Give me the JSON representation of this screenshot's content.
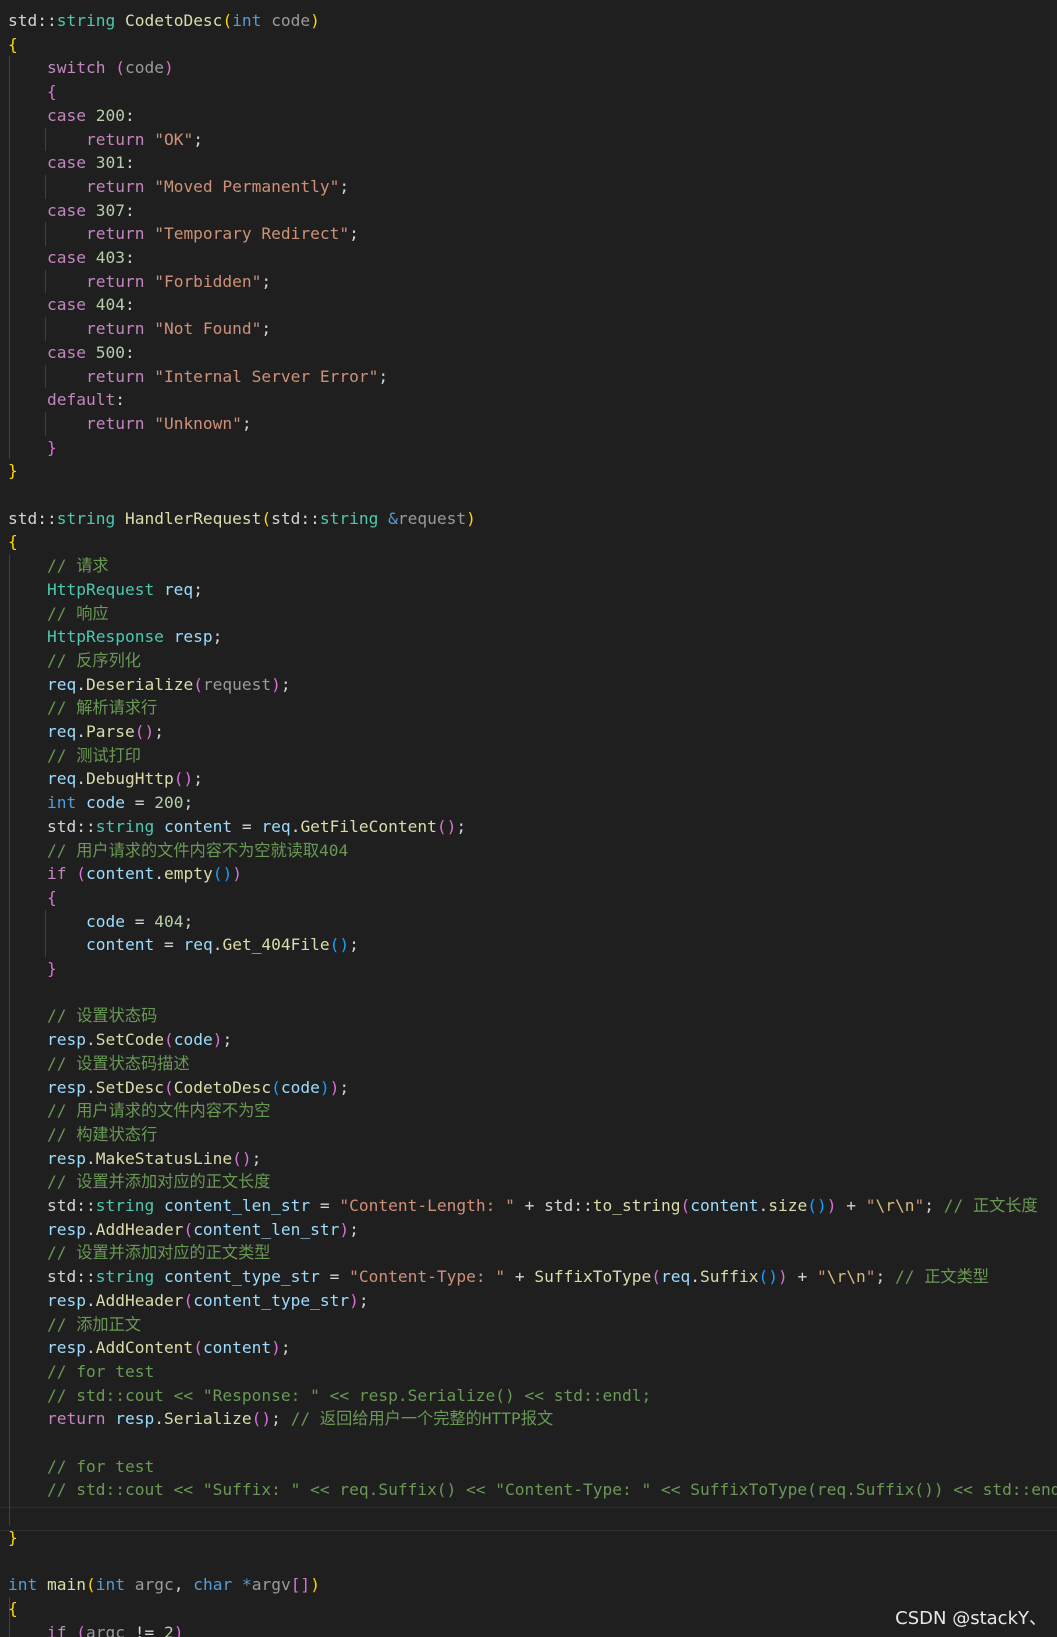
{
  "editor": {
    "theme_colors": {
      "background": "#1f1f1f",
      "keyword": "#569cd6",
      "control": "#c586c0",
      "type": "#4ec9b0",
      "function": "#dcdcaa",
      "string": "#ce9178",
      "number": "#b5cea8",
      "comment": "#6a9955",
      "bracket_1": "#ffd700",
      "bracket_2": "#da70d6",
      "bracket_3": "#179fff"
    },
    "lines": [
      [
        [
          "pl",
          "std::"
        ],
        [
          "ty",
          "string"
        ],
        [
          "pl",
          " "
        ],
        [
          "fn",
          "CodetoDesc"
        ],
        [
          "b1",
          "("
        ],
        [
          "kw",
          "int"
        ],
        [
          "pl",
          " "
        ],
        [
          "par",
          "code"
        ],
        [
          "b1",
          ")"
        ]
      ],
      [
        [
          "b1",
          "{"
        ]
      ],
      [
        [
          "pl",
          "    "
        ],
        [
          "ctl",
          "switch"
        ],
        [
          "pl",
          " "
        ],
        [
          "b2",
          "("
        ],
        [
          "par",
          "code"
        ],
        [
          "b2",
          ")"
        ]
      ],
      [
        [
          "pl",
          "    "
        ],
        [
          "b2",
          "{"
        ]
      ],
      [
        [
          "pl",
          "    "
        ],
        [
          "ctl",
          "case"
        ],
        [
          "pl",
          " "
        ],
        [
          "num",
          "200"
        ],
        [
          "pl",
          ":"
        ]
      ],
      [
        [
          "pl",
          "        "
        ],
        [
          "ctl",
          "return"
        ],
        [
          "pl",
          " "
        ],
        [
          "str",
          "\"OK\""
        ],
        [
          "pl",
          ";"
        ]
      ],
      [
        [
          "pl",
          "    "
        ],
        [
          "ctl",
          "case"
        ],
        [
          "pl",
          " "
        ],
        [
          "num",
          "301"
        ],
        [
          "pl",
          ":"
        ]
      ],
      [
        [
          "pl",
          "        "
        ],
        [
          "ctl",
          "return"
        ],
        [
          "pl",
          " "
        ],
        [
          "str",
          "\"Moved Permanently\""
        ],
        [
          "pl",
          ";"
        ]
      ],
      [
        [
          "pl",
          "    "
        ],
        [
          "ctl",
          "case"
        ],
        [
          "pl",
          " "
        ],
        [
          "num",
          "307"
        ],
        [
          "pl",
          ":"
        ]
      ],
      [
        [
          "pl",
          "        "
        ],
        [
          "ctl",
          "return"
        ],
        [
          "pl",
          " "
        ],
        [
          "str",
          "\"Temporary Redirect\""
        ],
        [
          "pl",
          ";"
        ]
      ],
      [
        [
          "pl",
          "    "
        ],
        [
          "ctl",
          "case"
        ],
        [
          "pl",
          " "
        ],
        [
          "num",
          "403"
        ],
        [
          "pl",
          ":"
        ]
      ],
      [
        [
          "pl",
          "        "
        ],
        [
          "ctl",
          "return"
        ],
        [
          "pl",
          " "
        ],
        [
          "str",
          "\"Forbidden\""
        ],
        [
          "pl",
          ";"
        ]
      ],
      [
        [
          "pl",
          "    "
        ],
        [
          "ctl",
          "case"
        ],
        [
          "pl",
          " "
        ],
        [
          "num",
          "404"
        ],
        [
          "pl",
          ":"
        ]
      ],
      [
        [
          "pl",
          "        "
        ],
        [
          "ctl",
          "return"
        ],
        [
          "pl",
          " "
        ],
        [
          "str",
          "\"Not Found\""
        ],
        [
          "pl",
          ";"
        ]
      ],
      [
        [
          "pl",
          "    "
        ],
        [
          "ctl",
          "case"
        ],
        [
          "pl",
          " "
        ],
        [
          "num",
          "500"
        ],
        [
          "pl",
          ":"
        ]
      ],
      [
        [
          "pl",
          "        "
        ],
        [
          "ctl",
          "return"
        ],
        [
          "pl",
          " "
        ],
        [
          "str",
          "\"Internal Server Error\""
        ],
        [
          "pl",
          ";"
        ]
      ],
      [
        [
          "pl",
          "    "
        ],
        [
          "ctl",
          "default"
        ],
        [
          "pl",
          ":"
        ]
      ],
      [
        [
          "pl",
          "        "
        ],
        [
          "ctl",
          "return"
        ],
        [
          "pl",
          " "
        ],
        [
          "str",
          "\"Unknown\""
        ],
        [
          "pl",
          ";"
        ]
      ],
      [
        [
          "pl",
          "    "
        ],
        [
          "b2",
          "}"
        ]
      ],
      [
        [
          "b1",
          "}"
        ]
      ],
      [],
      [
        [
          "pl",
          "std::"
        ],
        [
          "ty",
          "string"
        ],
        [
          "pl",
          " "
        ],
        [
          "fn",
          "HandlerRequest"
        ],
        [
          "b1",
          "("
        ],
        [
          "pl",
          "std::"
        ],
        [
          "ty",
          "string"
        ],
        [
          "pl",
          " "
        ],
        [
          "kw",
          "&"
        ],
        [
          "par",
          "request"
        ],
        [
          "b1",
          ")"
        ]
      ],
      [
        [
          "b1",
          "{"
        ]
      ],
      [
        [
          "pl",
          "    "
        ],
        [
          "com",
          "// 请求"
        ]
      ],
      [
        [
          "pl",
          "    "
        ],
        [
          "ty",
          "HttpRequest"
        ],
        [
          "pl",
          " "
        ],
        [
          "var",
          "req"
        ],
        [
          "pl",
          ";"
        ]
      ],
      [
        [
          "pl",
          "    "
        ],
        [
          "com",
          "// 响应"
        ]
      ],
      [
        [
          "pl",
          "    "
        ],
        [
          "ty",
          "HttpResponse"
        ],
        [
          "pl",
          " "
        ],
        [
          "var",
          "resp"
        ],
        [
          "pl",
          ";"
        ]
      ],
      [
        [
          "pl",
          "    "
        ],
        [
          "com",
          "// 反序列化"
        ]
      ],
      [
        [
          "pl",
          "    "
        ],
        [
          "var",
          "req"
        ],
        [
          "pl",
          "."
        ],
        [
          "fn",
          "Deserialize"
        ],
        [
          "b2",
          "("
        ],
        [
          "par",
          "request"
        ],
        [
          "b2",
          ")"
        ],
        [
          "pl",
          ";"
        ]
      ],
      [
        [
          "pl",
          "    "
        ],
        [
          "com",
          "// 解析请求行"
        ]
      ],
      [
        [
          "pl",
          "    "
        ],
        [
          "var",
          "req"
        ],
        [
          "pl",
          "."
        ],
        [
          "fn",
          "Parse"
        ],
        [
          "b2",
          "()"
        ],
        [
          "pl",
          ";"
        ]
      ],
      [
        [
          "pl",
          "    "
        ],
        [
          "com",
          "// 测试打印"
        ]
      ],
      [
        [
          "pl",
          "    "
        ],
        [
          "var",
          "req"
        ],
        [
          "pl",
          "."
        ],
        [
          "fn",
          "DebugHttp"
        ],
        [
          "b2",
          "()"
        ],
        [
          "pl",
          ";"
        ]
      ],
      [
        [
          "pl",
          "    "
        ],
        [
          "kw",
          "int"
        ],
        [
          "pl",
          " "
        ],
        [
          "var",
          "code"
        ],
        [
          "pl",
          " = "
        ],
        [
          "num",
          "200"
        ],
        [
          "pl",
          ";"
        ]
      ],
      [
        [
          "pl",
          "    std::"
        ],
        [
          "ty",
          "string"
        ],
        [
          "pl",
          " "
        ],
        [
          "var",
          "content"
        ],
        [
          "pl",
          " = "
        ],
        [
          "var",
          "req"
        ],
        [
          "pl",
          "."
        ],
        [
          "fn",
          "GetFileContent"
        ],
        [
          "b2",
          "()"
        ],
        [
          "pl",
          ";"
        ]
      ],
      [
        [
          "pl",
          "    "
        ],
        [
          "com",
          "// 用户请求的文件内容不为空就读取404"
        ]
      ],
      [
        [
          "pl",
          "    "
        ],
        [
          "ctl",
          "if"
        ],
        [
          "pl",
          " "
        ],
        [
          "b2",
          "("
        ],
        [
          "var",
          "content"
        ],
        [
          "pl",
          "."
        ],
        [
          "fn",
          "empty"
        ],
        [
          "b3",
          "()"
        ],
        [
          "b2",
          ")"
        ]
      ],
      [
        [
          "pl",
          "    "
        ],
        [
          "b2",
          "{"
        ]
      ],
      [
        [
          "pl",
          "        "
        ],
        [
          "var",
          "code"
        ],
        [
          "pl",
          " = "
        ],
        [
          "num",
          "404"
        ],
        [
          "pl",
          ";"
        ]
      ],
      [
        [
          "pl",
          "        "
        ],
        [
          "var",
          "content"
        ],
        [
          "pl",
          " = "
        ],
        [
          "var",
          "req"
        ],
        [
          "pl",
          "."
        ],
        [
          "fn",
          "Get_404File"
        ],
        [
          "b3",
          "()"
        ],
        [
          "pl",
          ";"
        ]
      ],
      [
        [
          "pl",
          "    "
        ],
        [
          "b2",
          "}"
        ]
      ],
      [],
      [
        [
          "pl",
          "    "
        ],
        [
          "com",
          "// 设置状态码"
        ]
      ],
      [
        [
          "pl",
          "    "
        ],
        [
          "var",
          "resp"
        ],
        [
          "pl",
          "."
        ],
        [
          "fn",
          "SetCode"
        ],
        [
          "b2",
          "("
        ],
        [
          "var",
          "code"
        ],
        [
          "b2",
          ")"
        ],
        [
          "pl",
          ";"
        ]
      ],
      [
        [
          "pl",
          "    "
        ],
        [
          "com",
          "// 设置状态码描述"
        ]
      ],
      [
        [
          "pl",
          "    "
        ],
        [
          "var",
          "resp"
        ],
        [
          "pl",
          "."
        ],
        [
          "fn",
          "SetDesc"
        ],
        [
          "b2",
          "("
        ],
        [
          "fn",
          "CodetoDesc"
        ],
        [
          "b3",
          "("
        ],
        [
          "var",
          "code"
        ],
        [
          "b3",
          ")"
        ],
        [
          "b2",
          ")"
        ],
        [
          "pl",
          ";"
        ]
      ],
      [
        [
          "pl",
          "    "
        ],
        [
          "com",
          "// 用户请求的文件内容不为空"
        ]
      ],
      [
        [
          "pl",
          "    "
        ],
        [
          "com",
          "// 构建状态行"
        ]
      ],
      [
        [
          "pl",
          "    "
        ],
        [
          "var",
          "resp"
        ],
        [
          "pl",
          "."
        ],
        [
          "fn",
          "MakeStatusLine"
        ],
        [
          "b2",
          "()"
        ],
        [
          "pl",
          ";"
        ]
      ],
      [
        [
          "pl",
          "    "
        ],
        [
          "com",
          "// 设置并添加对应的正文长度"
        ]
      ],
      [
        [
          "pl",
          "    std::"
        ],
        [
          "ty",
          "string"
        ],
        [
          "pl",
          " "
        ],
        [
          "var",
          "content_len_str"
        ],
        [
          "pl",
          " = "
        ],
        [
          "str",
          "\"Content-Length: \""
        ],
        [
          "pl",
          " + std::"
        ],
        [
          "fn",
          "to_string"
        ],
        [
          "b2",
          "("
        ],
        [
          "var",
          "content"
        ],
        [
          "pl",
          "."
        ],
        [
          "fn",
          "size"
        ],
        [
          "b3",
          "()"
        ],
        [
          "b2",
          ")"
        ],
        [
          "pl",
          " + "
        ],
        [
          "str",
          "\""
        ],
        [
          "esc",
          "\\r\\n"
        ],
        [
          "str",
          "\""
        ],
        [
          "pl",
          "; "
        ],
        [
          "com",
          "// 正文长度"
        ]
      ],
      [
        [
          "pl",
          "    "
        ],
        [
          "var",
          "resp"
        ],
        [
          "pl",
          "."
        ],
        [
          "fn",
          "AddHeader"
        ],
        [
          "b2",
          "("
        ],
        [
          "var",
          "content_len_str"
        ],
        [
          "b2",
          ")"
        ],
        [
          "pl",
          ";"
        ]
      ],
      [
        [
          "pl",
          "    "
        ],
        [
          "com",
          "// 设置并添加对应的正文类型"
        ]
      ],
      [
        [
          "pl",
          "    std::"
        ],
        [
          "ty",
          "string"
        ],
        [
          "pl",
          " "
        ],
        [
          "var",
          "content_type_str"
        ],
        [
          "pl",
          " = "
        ],
        [
          "str",
          "\"Content-Type: \""
        ],
        [
          "pl",
          " + "
        ],
        [
          "fn",
          "SuffixToType"
        ],
        [
          "b2",
          "("
        ],
        [
          "var",
          "req"
        ],
        [
          "pl",
          "."
        ],
        [
          "fn",
          "Suffix"
        ],
        [
          "b3",
          "()"
        ],
        [
          "b2",
          ")"
        ],
        [
          "pl",
          " + "
        ],
        [
          "str",
          "\""
        ],
        [
          "esc",
          "\\r\\n"
        ],
        [
          "str",
          "\""
        ],
        [
          "pl",
          "; "
        ],
        [
          "com",
          "// 正文类型"
        ]
      ],
      [
        [
          "pl",
          "    "
        ],
        [
          "var",
          "resp"
        ],
        [
          "pl",
          "."
        ],
        [
          "fn",
          "AddHeader"
        ],
        [
          "b2",
          "("
        ],
        [
          "var",
          "content_type_str"
        ],
        [
          "b2",
          ")"
        ],
        [
          "pl",
          ";"
        ]
      ],
      [
        [
          "pl",
          "    "
        ],
        [
          "com",
          "// 添加正文"
        ]
      ],
      [
        [
          "pl",
          "    "
        ],
        [
          "var",
          "resp"
        ],
        [
          "pl",
          "."
        ],
        [
          "fn",
          "AddContent"
        ],
        [
          "b2",
          "("
        ],
        [
          "var",
          "content"
        ],
        [
          "b2",
          ")"
        ],
        [
          "pl",
          ";"
        ]
      ],
      [
        [
          "pl",
          "    "
        ],
        [
          "com",
          "// for test"
        ]
      ],
      [
        [
          "pl",
          "    "
        ],
        [
          "com",
          "// std::cout << \"Response: \" << resp.Serialize() << std::endl;"
        ]
      ],
      [
        [
          "pl",
          "    "
        ],
        [
          "ctl",
          "return"
        ],
        [
          "pl",
          " "
        ],
        [
          "var",
          "resp"
        ],
        [
          "pl",
          "."
        ],
        [
          "fn",
          "Serialize"
        ],
        [
          "b2",
          "()"
        ],
        [
          "pl",
          "; "
        ],
        [
          "com",
          "// 返回给用户一个完整的HTTP报文"
        ]
      ],
      [],
      [
        [
          "pl",
          "    "
        ],
        [
          "com",
          "// for test"
        ]
      ],
      [
        [
          "pl",
          "    "
        ],
        [
          "com",
          "// std::cout << \"Suffix: \" << req.Suffix() << \"Content-Type: \" << SuffixToType(req.Suffix()) << std::endl"
        ]
      ],
      [],
      [
        [
          "b1",
          "}"
        ]
      ],
      [],
      [
        [
          "kw",
          "int"
        ],
        [
          "pl",
          " "
        ],
        [
          "fn",
          "main"
        ],
        [
          "b1",
          "("
        ],
        [
          "kw",
          "int"
        ],
        [
          "pl",
          " "
        ],
        [
          "par",
          "argc"
        ],
        [
          "pl",
          ", "
        ],
        [
          "kw",
          "char"
        ],
        [
          "pl",
          " "
        ],
        [
          "kw",
          "*"
        ],
        [
          "par",
          "argv"
        ],
        [
          "b2",
          "[]"
        ],
        [
          "b1",
          ")"
        ]
      ],
      [
        [
          "b1",
          "{"
        ]
      ],
      [
        [
          "pl",
          "    "
        ],
        [
          "ctl",
          "if"
        ],
        [
          "pl",
          " "
        ],
        [
          "b2",
          "("
        ],
        [
          "par",
          "argc"
        ],
        [
          "pl",
          " != "
        ],
        [
          "num",
          "2"
        ],
        [
          "b2",
          ")"
        ]
      ]
    ]
  },
  "watermark": "CSDN @stackY、"
}
